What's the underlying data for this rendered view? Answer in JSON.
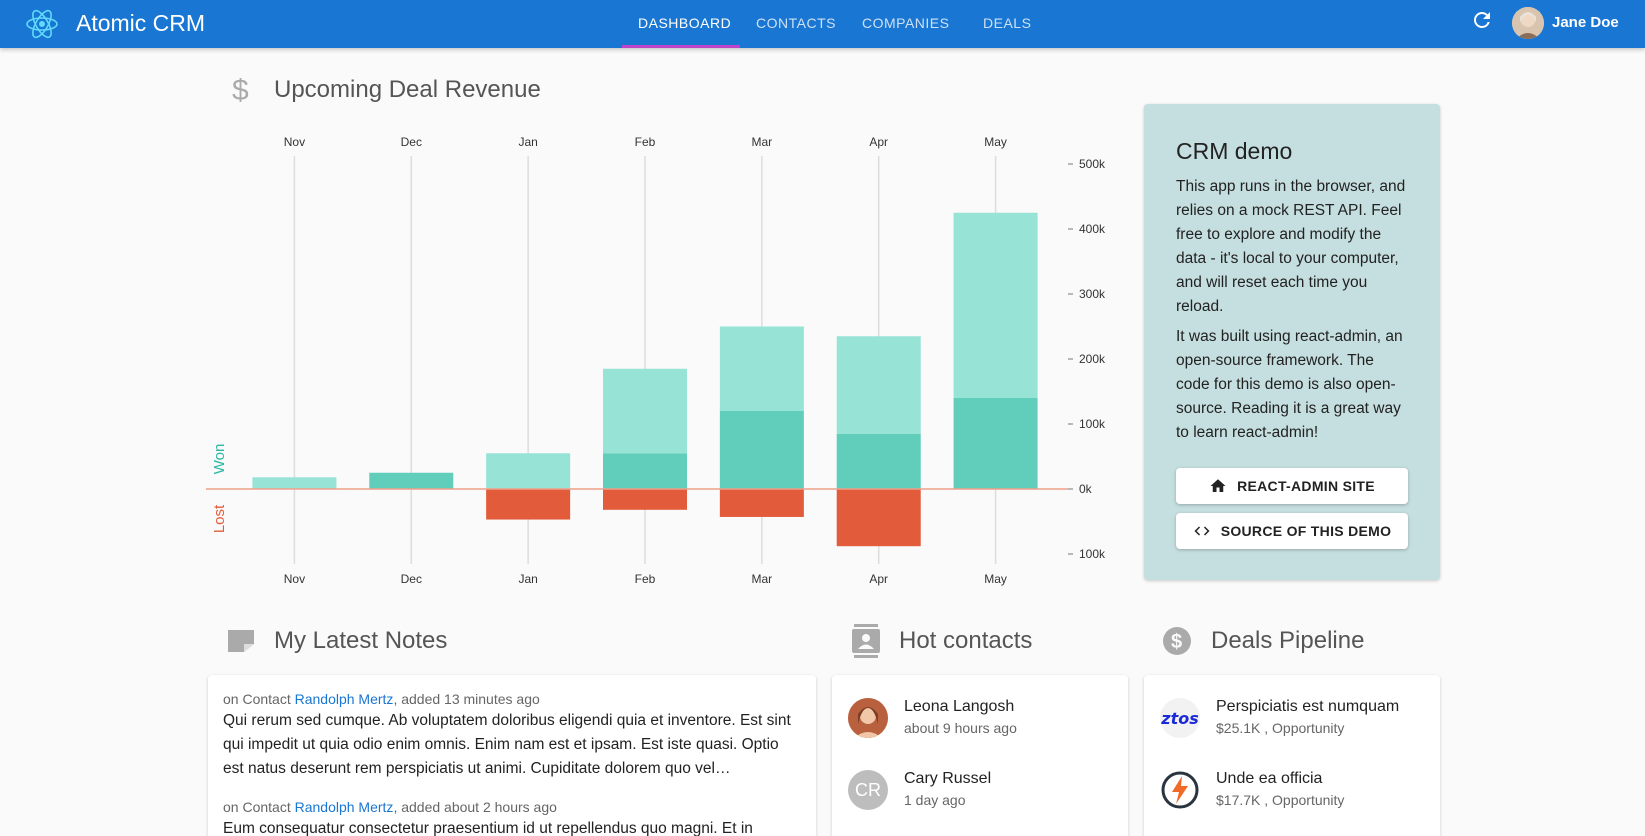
{
  "app": {
    "title": "Atomic CRM",
    "user": "Jane Doe"
  },
  "nav": {
    "tabs": [
      "Dashboard",
      "Contacts",
      "Companies",
      "Deals"
    ],
    "active": "Dashboard"
  },
  "revenue": {
    "title": "Upcoming Deal Revenue",
    "chart_data": {
      "type": "bar",
      "categories": [
        "Nov",
        "Dec",
        "Jan",
        "Feb",
        "Mar",
        "Apr",
        "May"
      ],
      "series": [
        {
          "name": "Won",
          "values": [
            0,
            25000,
            0,
            55000,
            120000,
            85000,
            140000
          ],
          "color": "#61cdbb"
        },
        {
          "name": "",
          "values": [
            18000,
            0,
            55000,
            130000,
            130000,
            150000,
            285000
          ],
          "color": "#97e3d5"
        },
        {
          "name": "Lost",
          "values": [
            0,
            0,
            -47000,
            -32000,
            -43000,
            -88000,
            0
          ],
          "color": "#e25c3b"
        }
      ],
      "ylim": [
        -100000,
        500000
      ],
      "yticks": [
        "500k",
        "400k",
        "300k",
        "200k",
        "100k",
        "0k",
        "100k"
      ],
      "axis_labels": {
        "won": "Won",
        "lost": "Lost"
      }
    }
  },
  "demo_card": {
    "title": "CRM demo",
    "p1": "This app runs in the browser, and relies on a mock REST API. Feel free to explore and modify the data - it's local to your computer, and will reset each time you reload.",
    "p2": "It was built using react-admin, an open-source framework. The code for this demo is also open-source. Reading it is a great way to learn react-admin!",
    "btn_site": "React-admin site",
    "btn_source": "Source of this demo"
  },
  "notes": {
    "title": "My Latest Notes",
    "items": [
      {
        "prefix": "on Contact",
        "contact": "Randolph Mertz",
        "added": ", added 13 minutes ago",
        "text": "Qui rerum sed cumque. Ab voluptatem doloribus eligendi quia et inventore. Est sint qui impedit ut quia odio enim omnis. Enim nam est et ipsam. Est iste quasi. Optio est natus deserunt rem perspiciatis ut animi. Cupiditate dolorem quo vel…"
      },
      {
        "prefix": "on Contact",
        "contact": "Randolph Mertz",
        "added": ", added about 2 hours ago",
        "text": "Eum consequatur consectetur praesentium id ut repellendus quo magni. Et in"
      }
    ]
  },
  "hot_contacts": {
    "title": "Hot contacts",
    "items": [
      {
        "name": "Leona Langosh",
        "time": "about 9 hours ago",
        "initials": ""
      },
      {
        "name": "Cary Russel",
        "time": "1 day ago",
        "initials": "CR"
      }
    ]
  },
  "pipeline": {
    "title": "Deals Pipeline",
    "items": [
      {
        "name": "Perspiciatis est numquam",
        "detail": "$25.1K , Opportunity",
        "logo_text": "ztos"
      },
      {
        "name": "Unde ea officia",
        "detail": "$17.7K , Opportunity",
        "logo_text": ""
      }
    ]
  }
}
